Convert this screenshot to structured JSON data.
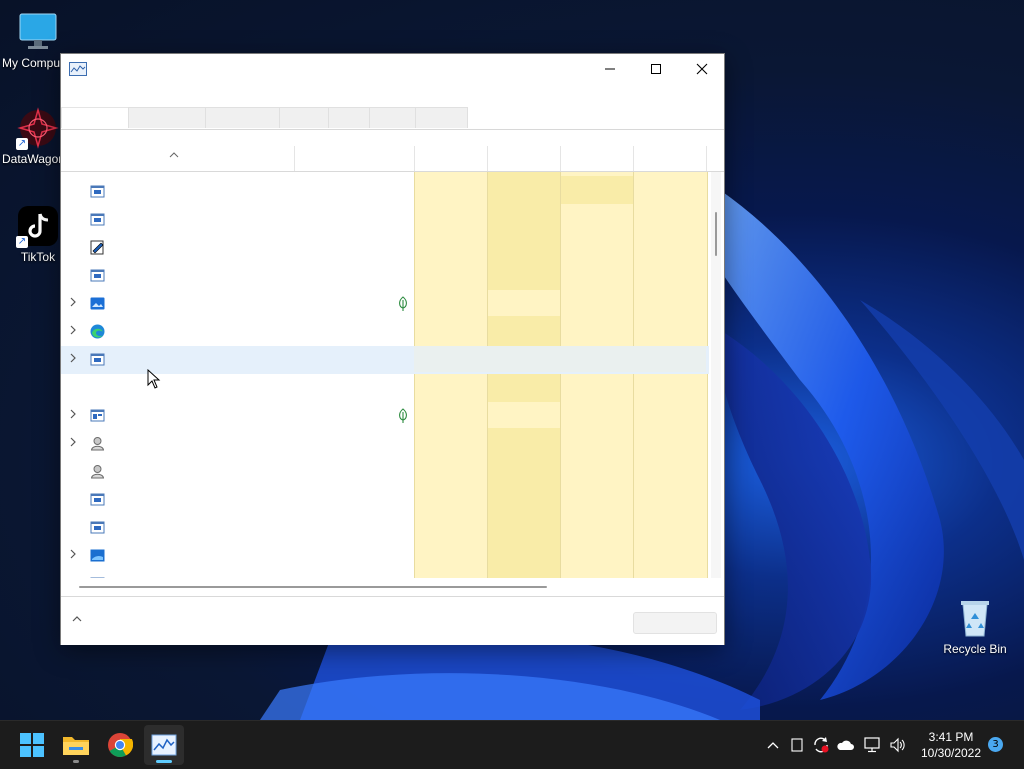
{
  "desktop": {
    "icons": [
      {
        "label": "My Computer",
        "icon": "monitor-icon"
      },
      {
        "label": "DataWagon",
        "icon": "datawagon-icon"
      },
      {
        "label": "TikTok",
        "icon": "tiktok-icon"
      },
      {
        "label": "Recycle Bin",
        "icon": "recycle-bin-icon"
      }
    ]
  },
  "window": {
    "title": "",
    "icon": "task-manager-icon",
    "tabs": [
      "",
      "",
      "",
      "",
      "",
      "",
      ""
    ],
    "columns": [
      "",
      "",
      "",
      "",
      "",
      ""
    ],
    "rows": [
      {
        "icon": "app-window-icon",
        "expandable": false,
        "leaf": false,
        "selected": false
      },
      {
        "icon": "app-window-icon",
        "expandable": false,
        "leaf": false,
        "selected": false
      },
      {
        "icon": "notepad-icon",
        "expandable": false,
        "leaf": false,
        "selected": false
      },
      {
        "icon": "app-window-icon",
        "expandable": false,
        "leaf": false,
        "selected": false
      },
      {
        "icon": "photo-app-icon",
        "expandable": true,
        "leaf": true,
        "selected": false
      },
      {
        "icon": "edge-icon",
        "expandable": true,
        "leaf": false,
        "selected": false
      },
      {
        "icon": "app-window-icon",
        "expandable": true,
        "leaf": false,
        "selected": true
      },
      {
        "icon": "",
        "expandable": false,
        "leaf": false,
        "selected": false
      },
      {
        "icon": "app-window-icon",
        "expandable": true,
        "leaf": true,
        "selected": false
      },
      {
        "icon": "user-service-icon",
        "expandable": true,
        "leaf": false,
        "selected": false
      },
      {
        "icon": "user-service-icon",
        "expandable": false,
        "leaf": false,
        "selected": false
      },
      {
        "icon": "app-window-icon",
        "expandable": false,
        "leaf": false,
        "selected": false
      },
      {
        "icon": "app-window-icon",
        "expandable": false,
        "leaf": false,
        "selected": false
      },
      {
        "icon": "windows-app-icon",
        "expandable": true,
        "leaf": false,
        "selected": false
      }
    ],
    "footer": {
      "fewer_details": "",
      "end_task": ""
    }
  },
  "taskbar": {
    "apps": [
      "start-icon",
      "file-explorer-icon",
      "chrome-icon",
      "task-manager-icon"
    ],
    "tray": [
      "chevron-up-icon",
      "tablet-icon",
      "sync-icon",
      "onedrive-icon",
      "network-icon",
      "volume-icon"
    ],
    "time": "3:41 PM",
    "date": "10/30/2022",
    "notification_count": "3"
  },
  "colors": {
    "heat_light": "#fff4c4",
    "heat_mid": "#f9eca8",
    "selected_row": "#e5f0fb",
    "accent": "#60cdff"
  }
}
